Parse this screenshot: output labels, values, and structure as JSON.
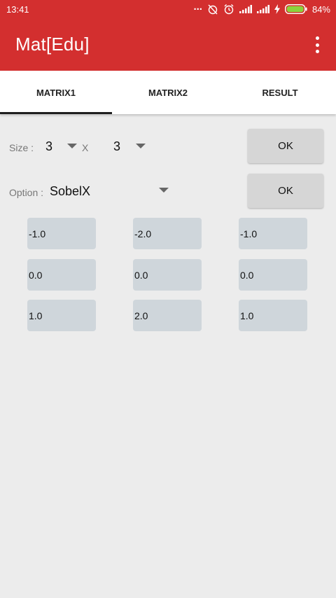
{
  "status_bar": {
    "time": "13:41",
    "dots": "...",
    "battery_pct": "84%"
  },
  "app_bar": {
    "title": "Mat[Edu]"
  },
  "tabs": [
    {
      "label": "MATRIX1",
      "active": true
    },
    {
      "label": "MATRIX2",
      "active": false
    },
    {
      "label": "RESULT",
      "active": false
    }
  ],
  "size_row": {
    "label": "Size :",
    "rows": "3",
    "x": "X",
    "cols": "3",
    "ok": "OK"
  },
  "option_row": {
    "label": "Option :",
    "value": "SobelX",
    "ok": "OK"
  },
  "matrix": [
    [
      "-1.0",
      "-2.0",
      "-1.0"
    ],
    [
      "0.0",
      "0.0",
      "0.0"
    ],
    [
      "1.0",
      "2.0",
      "1.0"
    ]
  ],
  "colors": {
    "primary": "#d32f2f",
    "cell": "#cfd6db",
    "background": "#ececec"
  }
}
